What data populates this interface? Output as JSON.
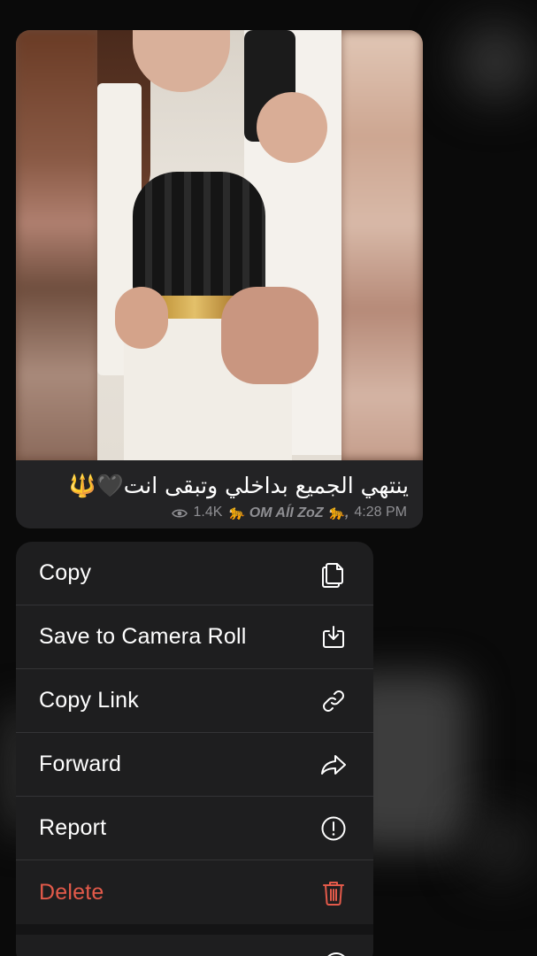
{
  "message": {
    "caption": "ينتهي الجميع بداخلي وتبقى انت🖤🔱",
    "views": "1.4K",
    "author": "🐆 OM AĺI ZoZ 🐆,",
    "time": "4:28 PM",
    "icons": {
      "views": "eye-icon"
    }
  },
  "menu": {
    "items": [
      {
        "label": "Copy",
        "icon": "copy-icon"
      },
      {
        "label": "Save to Camera Roll",
        "icon": "save-download-icon"
      },
      {
        "label": "Copy Link",
        "icon": "link-icon"
      },
      {
        "label": "Forward",
        "icon": "forward-arrow-icon"
      },
      {
        "label": "Report",
        "icon": "exclamation-circle-icon"
      },
      {
        "label": "Delete",
        "icon": "trash-icon"
      }
    ],
    "colors": {
      "delete": "#e35a4a",
      "text": "#ffffff",
      "background": "#1e1e1f"
    }
  }
}
